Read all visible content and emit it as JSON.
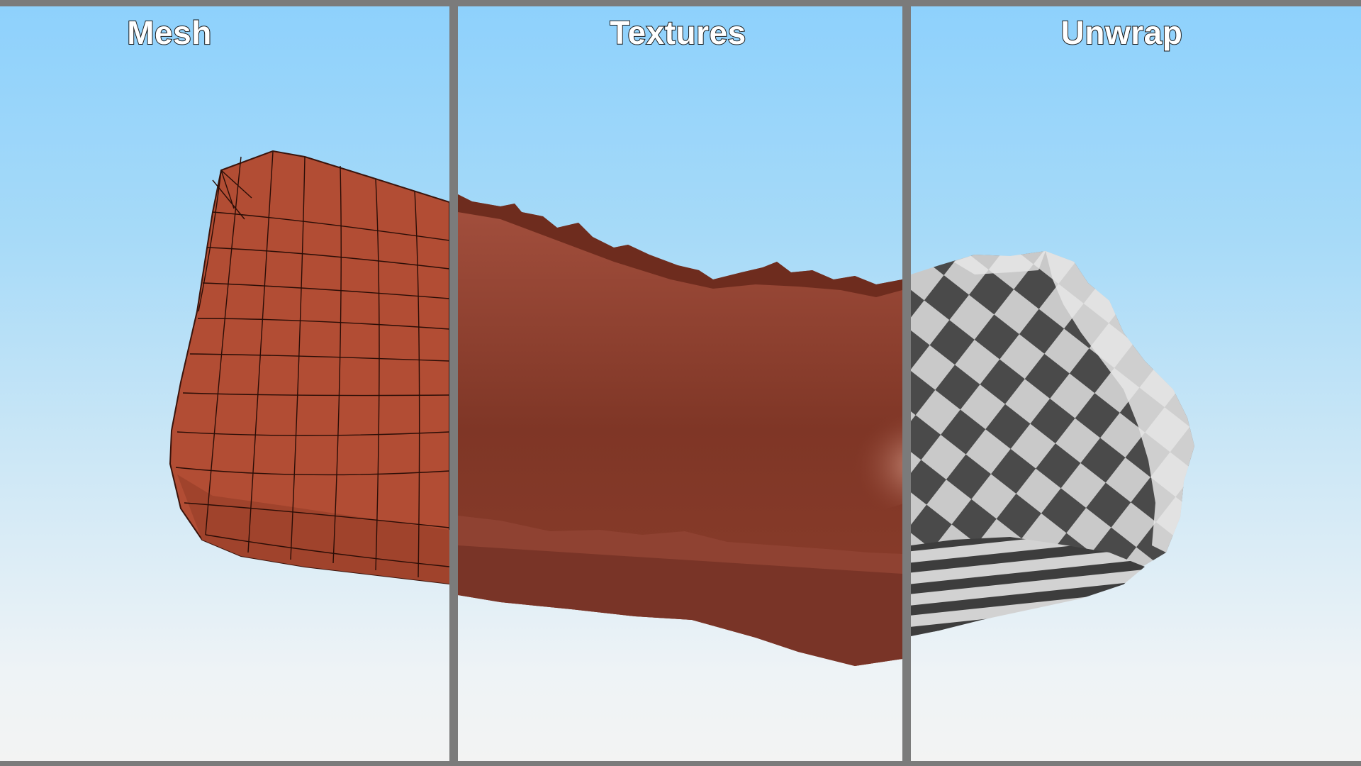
{
  "panels": [
    {
      "title": "Mesh"
    },
    {
      "title": "Textures"
    },
    {
      "title": "Unwrap"
    }
  ],
  "colors": {
    "frame": "#7b7b7b",
    "sky_top": "#8ed1fc",
    "sky_bottom": "#f3f3f3",
    "clay": "#b24d34",
    "clay_textured": "#8a3d2c",
    "checker_dark": "#4a4a4a",
    "checker_light": "#c9c9c9"
  }
}
